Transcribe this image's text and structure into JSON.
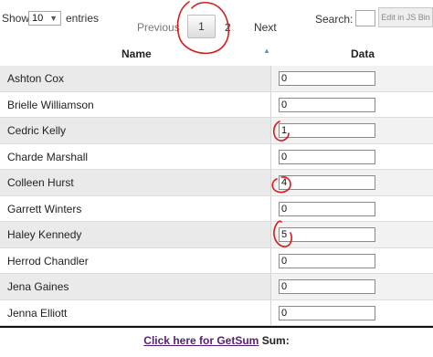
{
  "controls": {
    "show_label": "Show",
    "page_length": "10",
    "entries_label": "entries",
    "search_label": "Search:",
    "search_value": "",
    "jsbin_label": "Edit in JS Bin"
  },
  "pager": {
    "previous": "Previous",
    "current_page": "1",
    "page_2": "2",
    "next": "Next"
  },
  "table": {
    "headers": {
      "name": "Name",
      "data": "Data"
    },
    "rows": [
      {
        "name": "Ashton Cox",
        "value": "0"
      },
      {
        "name": "Brielle Williamson",
        "value": "0"
      },
      {
        "name": "Cedric Kelly",
        "value": "1"
      },
      {
        "name": "Charde Marshall",
        "value": "0"
      },
      {
        "name": "Colleen Hurst",
        "value": "4"
      },
      {
        "name": "Garrett Winters",
        "value": "0"
      },
      {
        "name": "Haley Kennedy",
        "value": "5"
      },
      {
        "name": "Herrod Chandler",
        "value": "0"
      },
      {
        "name": "Jena Gaines",
        "value": "0"
      },
      {
        "name": "Jenna Elliott",
        "value": "0"
      }
    ]
  },
  "footer": {
    "link_text": "Click here for GetSum",
    "sum_label": "Sum:"
  },
  "colors": {
    "annotation": "#d81a1a",
    "link": "#5b1a7a"
  }
}
